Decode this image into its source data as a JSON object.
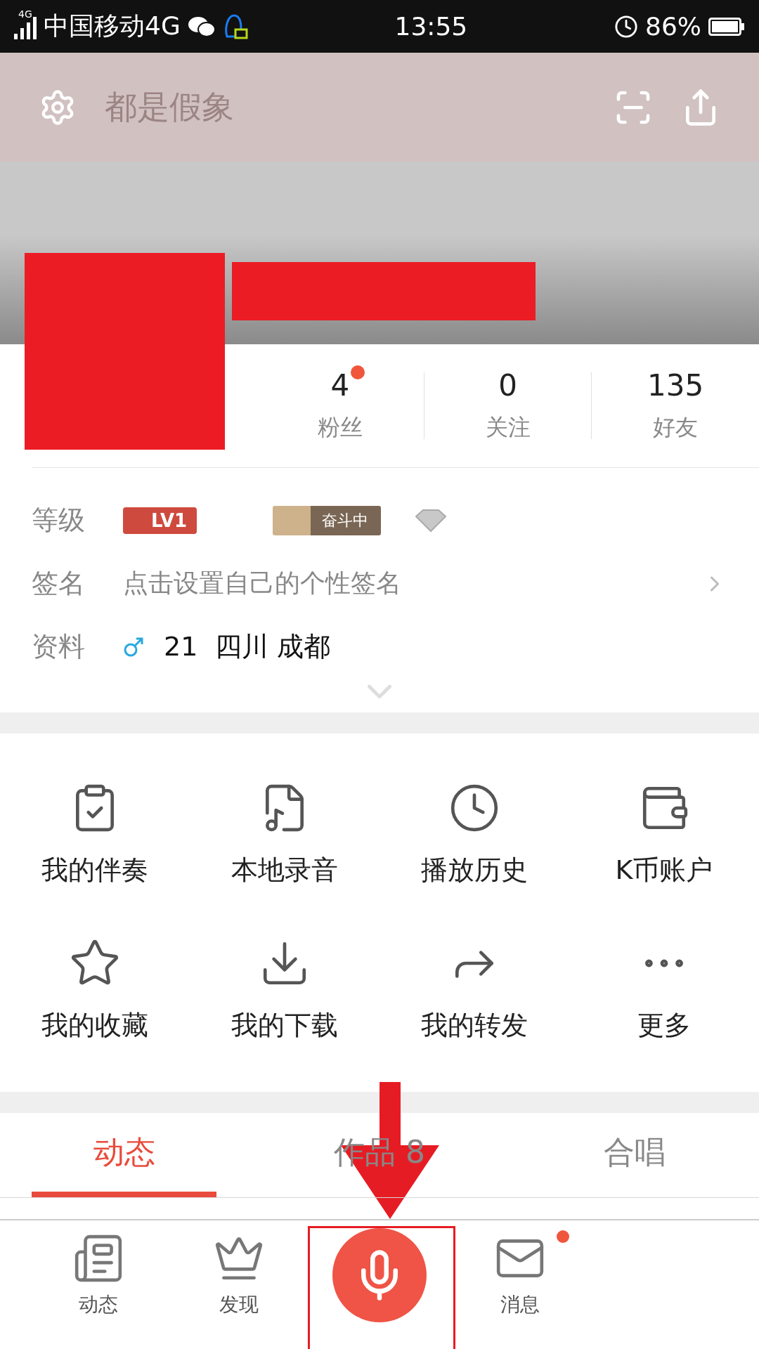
{
  "status_bar": {
    "network_badge": "4G",
    "carrier": "中国移动4G",
    "time": "13:55",
    "battery": "86%"
  },
  "header": {
    "title": "都是假象"
  },
  "stats": [
    {
      "value": "4",
      "label": "粉丝",
      "new": true
    },
    {
      "value": "0",
      "label": "关注",
      "new": false
    },
    {
      "value": "135",
      "label": "好友",
      "new": false
    }
  ],
  "profile": {
    "level_label": "等级",
    "level_badge": "LV1",
    "rank_badge": "奋斗中",
    "signature_label": "签名",
    "signature_placeholder": "点击设置自己的个性签名",
    "info_label": "资料",
    "info": "21  四川 成都"
  },
  "shortcuts": [
    {
      "label": "我的伴奏",
      "kind": "accompaniment"
    },
    {
      "label": "本地录音",
      "kind": "recording"
    },
    {
      "label": "播放历史",
      "kind": "history"
    },
    {
      "label": "K币账户",
      "kind": "wallet"
    },
    {
      "label": "我的收藏",
      "kind": "favorites"
    },
    {
      "label": "我的下载",
      "kind": "downloads"
    },
    {
      "label": "我的转发",
      "kind": "shares"
    },
    {
      "label": "更多",
      "kind": "more"
    }
  ],
  "tabs": [
    {
      "label": "动态",
      "selected": true
    },
    {
      "label": "作品 8",
      "selected": false
    },
    {
      "label": "合唱",
      "selected": false
    }
  ],
  "bottom_nav": [
    {
      "label": "动态",
      "kind": "feed",
      "badge": false
    },
    {
      "label": "发现",
      "kind": "discover",
      "badge": false
    },
    {
      "kind": "record",
      "badge": false
    },
    {
      "label": "消息",
      "kind": "messages",
      "badge": true
    }
  ]
}
